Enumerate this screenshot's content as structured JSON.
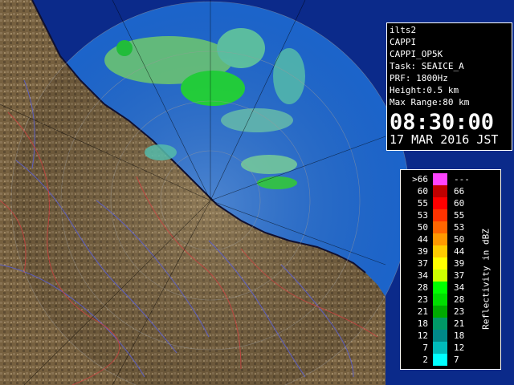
{
  "info": {
    "lines": [
      "ilts2",
      "CAPPI",
      "CAPPI_OP5K",
      "Task: SEAICE_A",
      "PRF: 1800Hz",
      "Height:0.5 km",
      "Max Range:80 km"
    ],
    "time": "08:30:00",
    "date": "17 MAR 2016 JST"
  },
  "legend": {
    "unit_label": "Reflectivity in dBZ",
    "rows": [
      {
        "low": ">66",
        "high": "---",
        "color": "#ff44ff"
      },
      {
        "low": "60",
        "high": "66",
        "color": "#c00000"
      },
      {
        "low": "55",
        "high": "60",
        "color": "#ff0000"
      },
      {
        "low": "53",
        "high": "55",
        "color": "#ff3300"
      },
      {
        "low": "50",
        "high": "53",
        "color": "#ff6600"
      },
      {
        "low": "44",
        "high": "50",
        "color": "#ff9900"
      },
      {
        "low": "39",
        "high": "44",
        "color": "#ffcc00"
      },
      {
        "low": "37",
        "high": "39",
        "color": "#ffff00"
      },
      {
        "low": "34",
        "high": "37",
        "color": "#ccff00"
      },
      {
        "low": "28",
        "high": "34",
        "color": "#00ff00"
      },
      {
        "low": "23",
        "high": "28",
        "color": "#00dd00"
      },
      {
        "low": "21",
        "high": "23",
        "color": "#00aa00"
      },
      {
        "low": "18",
        "high": "21",
        "color": "#009966"
      },
      {
        "low": "12",
        "high": "18",
        "color": "#008888"
      },
      {
        "low": "7",
        "high": "12",
        "color": "#00bbbb"
      },
      {
        "low": "2",
        "high": "7",
        "color": "#00ffff"
      }
    ]
  },
  "colors": {
    "land": "#7a6548",
    "sea": "#1f6fe0",
    "outside": "#0b2a8a"
  }
}
